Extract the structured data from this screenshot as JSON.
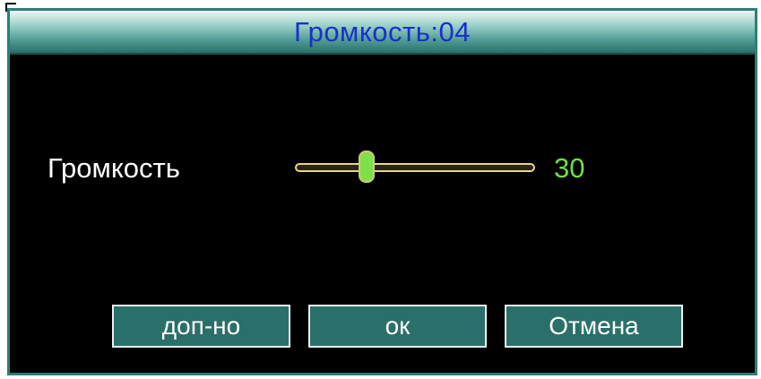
{
  "dialog": {
    "title": "Громкость:04"
  },
  "volume": {
    "label": "Громкость",
    "value": "30",
    "slider_fraction": 0.3
  },
  "buttons": {
    "advanced_label": "доп-но",
    "ok_label": "ок",
    "cancel_label": "Отмена"
  },
  "colors": {
    "title_text": "#1b2fc9",
    "value_text": "#6fe23b",
    "button_fill": "#2b6f6a",
    "slider_thumb": "#7fe04a",
    "slider_track": "#e7d58d"
  }
}
